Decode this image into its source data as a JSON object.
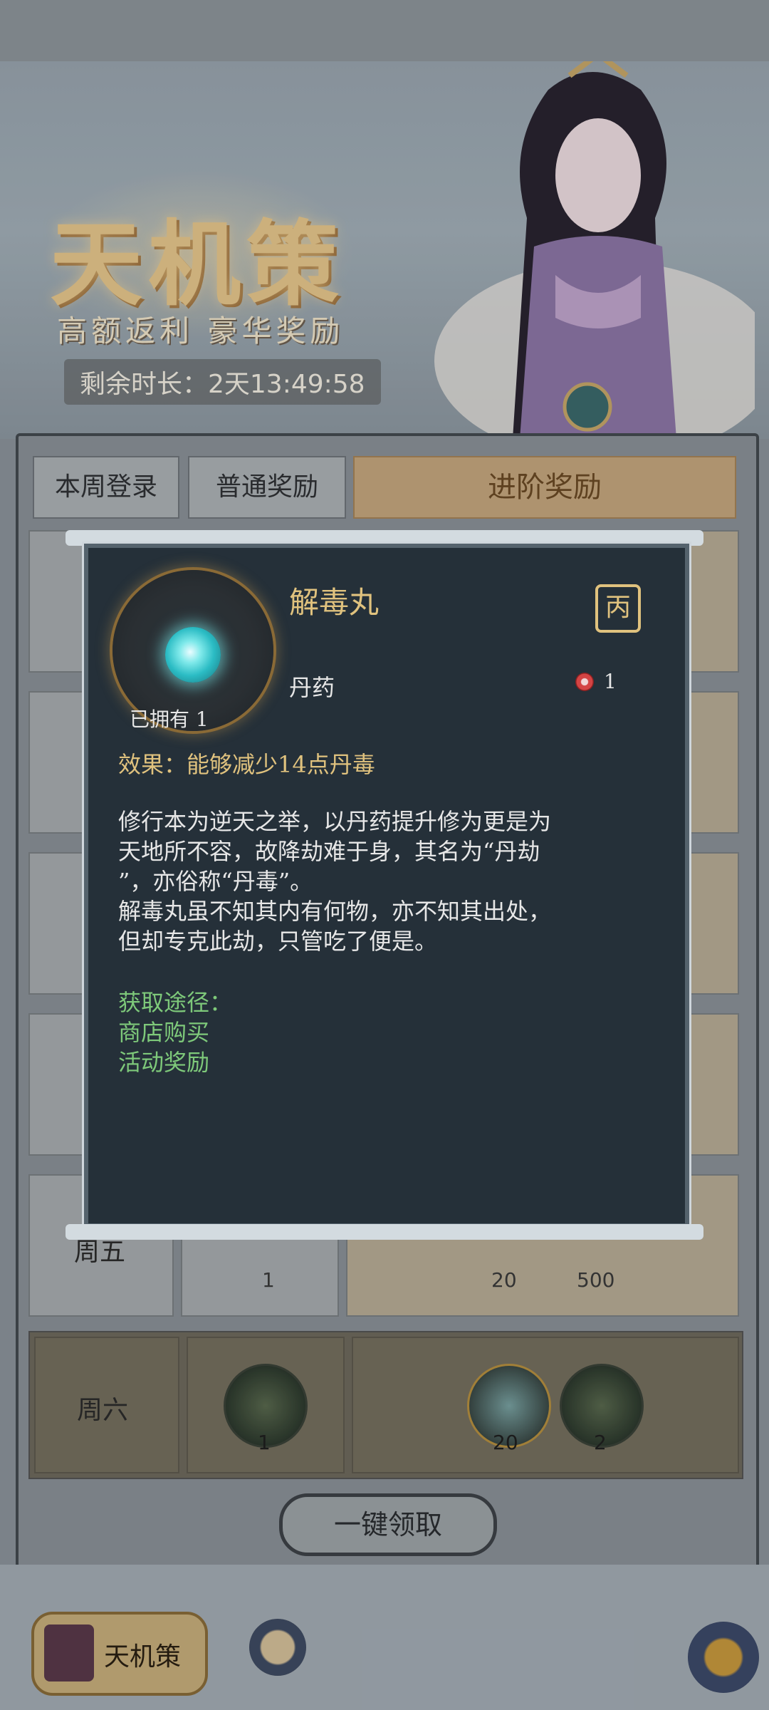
{
  "banner": {
    "title": "天机策",
    "subtitle": "高额返利 豪华奖励",
    "timer": "剩余时长：2天13:49:58"
  },
  "tabs": [
    {
      "label": "本周登录"
    },
    {
      "label": "普通奖励"
    },
    {
      "label": "进阶奖励"
    }
  ],
  "rows": {
    "fri_label": "周五",
    "fri_counts": [
      "1",
      "20",
      "500"
    ],
    "sat_label": "周六",
    "sat_counts": [
      "1",
      "20",
      "2"
    ]
  },
  "claim_button": "一键领取",
  "bottom_nav": {
    "active_label": "天机策"
  },
  "modal": {
    "name": "解毒丸",
    "owned": "已拥有 1",
    "type": "丹药",
    "seal_char": "丙",
    "cost": "1",
    "effect": "效果：能够减少14点丹毒",
    "desc_lines": [
      "修行本为逆天之举，以丹药提升修为更是为",
      "天地所不容，故降劫难于身，其名为“丹劫",
      "”，亦俗称“丹毒”。",
      "解毒丸虽不知其内有何物，亦不知其出处，",
      "但却专克此劫，只管吃了便是。"
    ],
    "source_title": "获取途径：",
    "sources": [
      "商店购买",
      "活动奖励"
    ]
  },
  "colors": {
    "modal_bg": "#253039",
    "gold_text": "#e0c27e",
    "green_text": "#7ec97a"
  }
}
